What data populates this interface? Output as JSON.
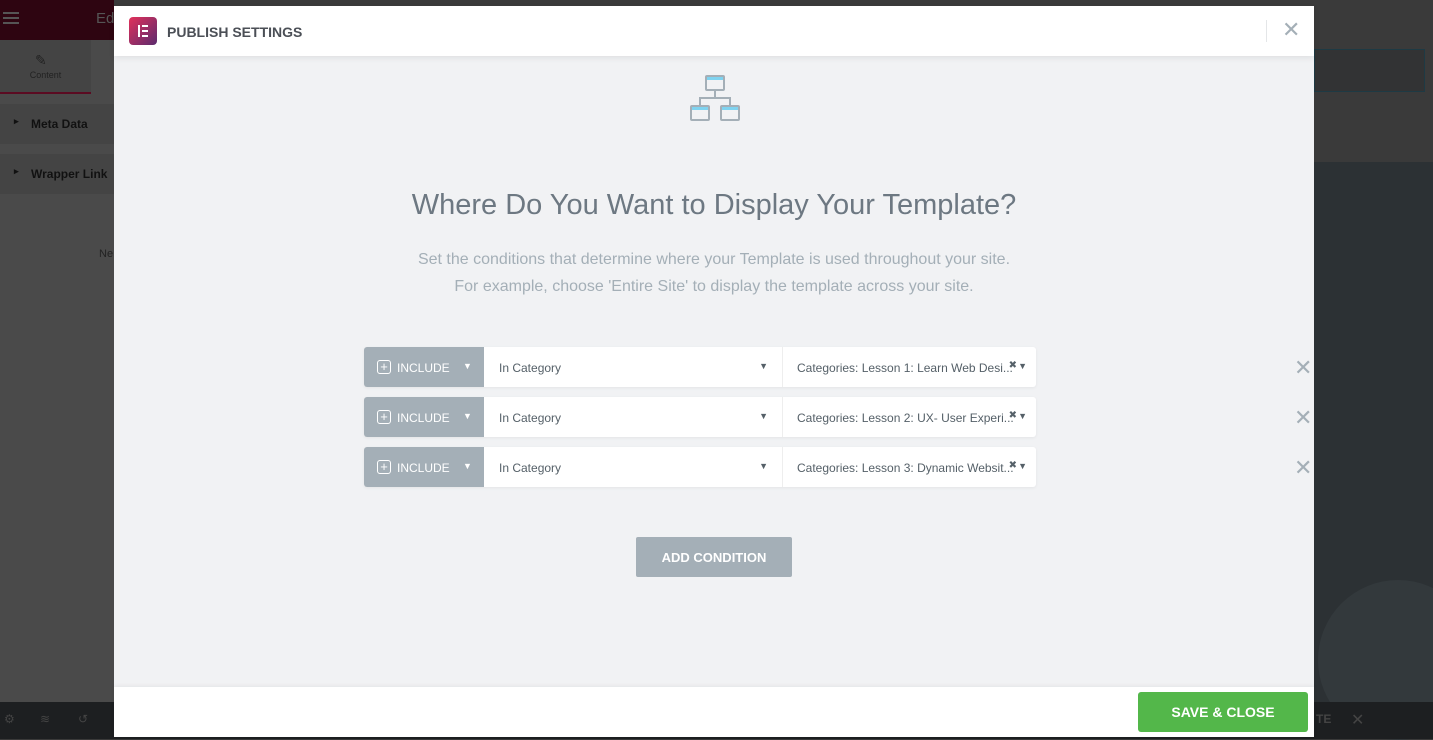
{
  "editor": {
    "title": "Ed",
    "tab_content": "Content",
    "sections": [
      "Meta Data",
      "Wrapper Link"
    ],
    "partial_text": "Ne",
    "bottom_partial": "TE"
  },
  "modal": {
    "title": "PUBLISH SETTINGS",
    "heading": "Where Do You Want to Display Your Template?",
    "description_line1": "Set the conditions that determine where your Template is used throughout your site.",
    "description_line2": "For example, choose 'Entire Site' to display the template across your site.",
    "conditions": [
      {
        "type": "INCLUDE",
        "rule": "In Category",
        "value": "Categories: Lesson 1: Learn Web Desi..."
      },
      {
        "type": "INCLUDE",
        "rule": "In Category",
        "value": "Categories: Lesson 2: UX- User Experi..."
      },
      {
        "type": "INCLUDE",
        "rule": "In Category",
        "value": "Categories: Lesson 3: Dynamic Websit..."
      }
    ],
    "add_condition_label": "ADD CONDITION",
    "save_label": "SAVE & CLOSE"
  },
  "colors": {
    "accent_green": "#53b74a",
    "include_gray": "#a4afb7",
    "brand": "#e2305a"
  },
  "icons": {
    "header": "elementor-logo",
    "illustration": "sitemap-icon"
  }
}
